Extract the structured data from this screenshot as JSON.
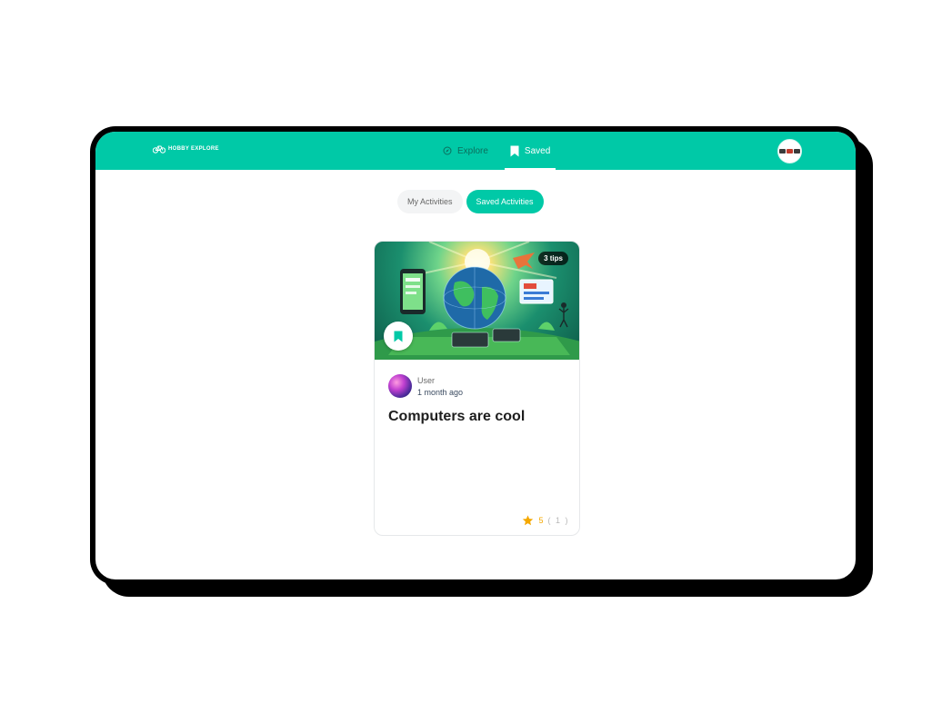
{
  "brand": {
    "name": "HOBBY EXPLORE"
  },
  "nav": {
    "tabs": [
      {
        "label": "Explore",
        "icon": "compass-icon",
        "active": false
      },
      {
        "label": "Saved",
        "icon": "bookmark-icon",
        "active": true
      }
    ]
  },
  "toggle": {
    "options": [
      {
        "label": "My Activities",
        "selected": false
      },
      {
        "label": "Saved Activities",
        "selected": true
      }
    ]
  },
  "card": {
    "tips_badge": "3 tips",
    "author": {
      "name": "User",
      "time": "1 month ago"
    },
    "title": "Computers are cool",
    "rating": {
      "value": "5",
      "count": "( 1 )"
    },
    "image_alt": "illustration of a globe with computers and devices"
  },
  "colors": {
    "accent": "#00c9a7",
    "star": "#f5a800",
    "text_dark": "#1e1e1e"
  }
}
